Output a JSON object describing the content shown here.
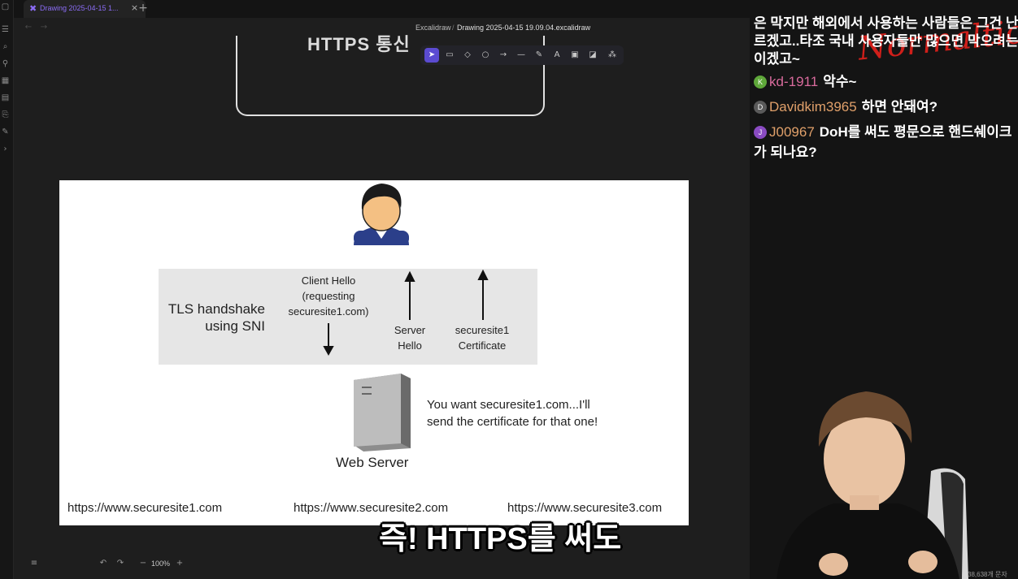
{
  "tabbar": {
    "tab_label": "Drawing 2025-04-15 1...",
    "tab_icon": "excalidraw-icon",
    "close_glyph": "×",
    "new_tab_glyph": "+"
  },
  "breadcrumb": {
    "folder": "Excalidraw",
    "separator": "/",
    "file": "Drawing 2025-04-15 19.09.04.excalidraw"
  },
  "toolbar": {
    "tools": [
      "selection-icon",
      "rectangle-icon",
      "diamond-icon",
      "ellipse-icon",
      "arrow-icon",
      "line-icon",
      "pencil-icon",
      "text-icon",
      "image-icon",
      "eraser-icon",
      "more-tools-icon"
    ],
    "active_tool": "selection"
  },
  "canvas": {
    "frame_title": "HTTPS 통신"
  },
  "slide": {
    "tls_label_line1": "TLS handshake",
    "tls_label_line2": "using SNI",
    "client_hello_line1": "Client Hello",
    "client_hello_line2": "(requesting",
    "client_hello_line3": "securesite1.com)",
    "server_hello_line1": "Server",
    "server_hello_line2": "Hello",
    "certificate_line1": "securesite1",
    "certificate_line2": "Certificate",
    "server_label": "Web Server",
    "speech_line1": "You want securesite1.com...I'll",
    "speech_line2": "send the certificate for that one!",
    "urls": [
      "https://www.securesite1.com",
      "https://www.securesite2.com",
      "https://www.securesite3.com"
    ]
  },
  "bottom_bar": {
    "zoom": "100%",
    "zoom_minus": "−",
    "zoom_plus": "+"
  },
  "subtitle": "즉! HTTPS를 써도",
  "chat": {
    "logo_text": "Normaltic",
    "partial_lines": [
      "은 막지만 해외에서 사용하는 사람들은 그건 난 모",
      "르겠고..타조 국내 사용자들만 많으면 막으려는",
      "이겠고~"
    ],
    "messages": [
      {
        "avatar": "K",
        "avatar_color": "#5fa83a",
        "user": "kd-1911",
        "user_color": "#d86a9c",
        "text": "악수~"
      },
      {
        "avatar": "D",
        "avatar_color": "#5a5a5a",
        "user": "Davidkim3965",
        "user_color": "#e0a06a",
        "text": "하면 안돼여?"
      },
      {
        "avatar": "J",
        "avatar_color": "#8a4bc2",
        "user": "J00967",
        "user_color": "#e0a06a",
        "text": "DoH를 써도 평문으로 핸드쉐이크가 되나요?"
      }
    ]
  },
  "char_count": "38,638개 문자"
}
